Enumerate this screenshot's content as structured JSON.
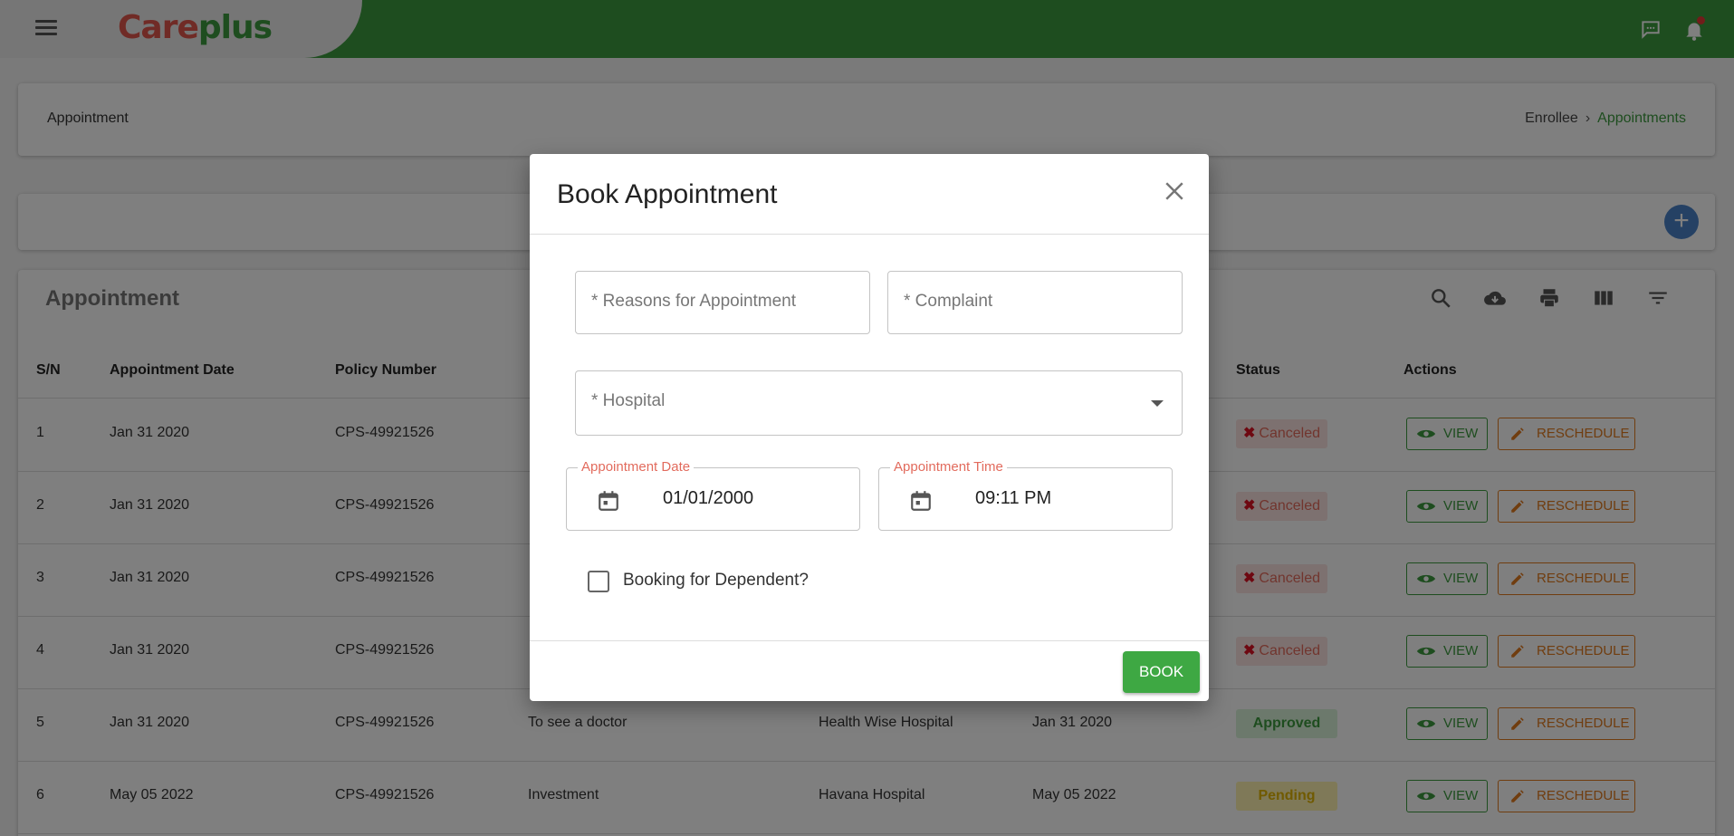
{
  "app": {
    "brand_part1": "Care",
    "brand_part2": "plus"
  },
  "breadcrumb": {
    "title": "Appointment",
    "home": "Enrollee",
    "active": "Appointments"
  },
  "table": {
    "title": "Appointment",
    "headers": [
      "S/N",
      "Appointment Date",
      "Policy Number",
      "Status",
      "Actions"
    ],
    "rows": [
      {
        "sn": "1",
        "date": "Jan 31 2020",
        "policy": "CPS-49921526",
        "reason": "",
        "hospital": "",
        "appt": "",
        "status": "Canceled"
      },
      {
        "sn": "2",
        "date": "Jan 31 2020",
        "policy": "CPS-49921526",
        "reason": "",
        "hospital": "",
        "appt": "",
        "status": "Canceled"
      },
      {
        "sn": "3",
        "date": "Jan 31 2020",
        "policy": "CPS-49921526",
        "reason": "",
        "hospital": "",
        "appt": "",
        "status": "Canceled"
      },
      {
        "sn": "4",
        "date": "Jan 31 2020",
        "policy": "CPS-49921526",
        "reason": "",
        "hospital": "",
        "appt": "",
        "status": "Canceled"
      },
      {
        "sn": "5",
        "date": "Jan 31 2020",
        "policy": "CPS-49921526",
        "reason": "To see a doctor",
        "hospital": "Health Wise Hospital",
        "appt": "Jan 31 2020",
        "status": "Approved"
      },
      {
        "sn": "6",
        "date": "May 05 2022",
        "policy": "CPS-49921526",
        "reason": "Investment",
        "hospital": "Havana Hospital",
        "appt": "May 05 2022",
        "status": "Pending"
      }
    ],
    "view_label": "VIEW",
    "reschedule_label": "RESCHEDULE"
  },
  "modal": {
    "title": "Book Appointment",
    "reason_placeholder": "* Reasons for Appointment",
    "complaint_placeholder": "* Complaint",
    "hospital_placeholder": "* Hospital",
    "date_label": "Appointment Date",
    "date_value": "01/01/2000",
    "time_label": "Appointment Time",
    "time_value": "09:11 PM",
    "dependent_label": "Booking for Dependent?",
    "book_label": "BOOK"
  },
  "colors": {
    "brand_green": "#3c9a3f",
    "brand_red": "#e0574c",
    "warning_orange": "#e07a1f"
  }
}
